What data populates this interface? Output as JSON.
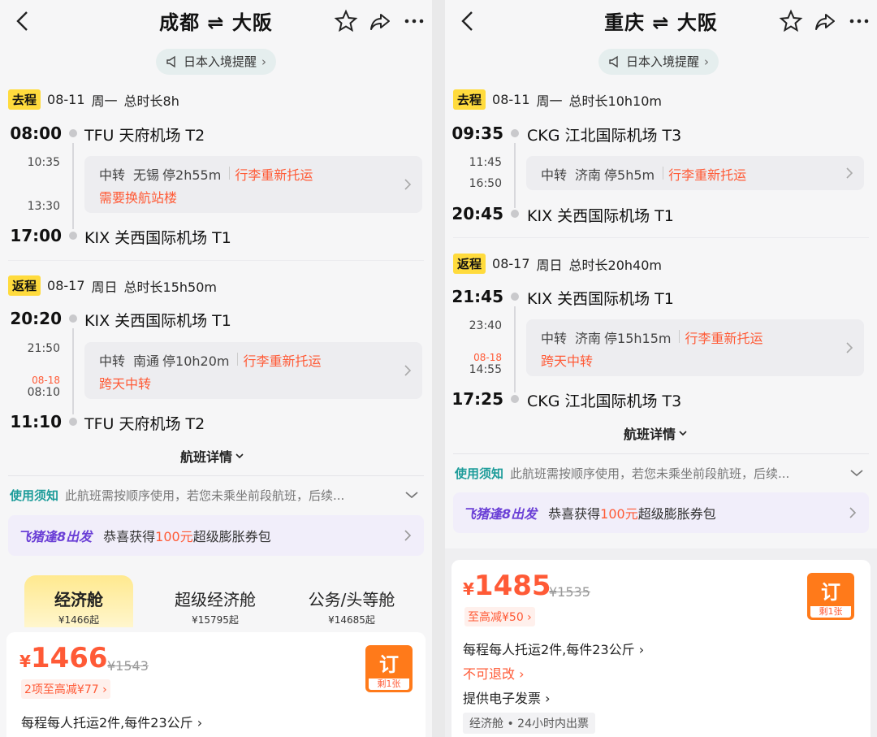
{
  "left": {
    "title": "成都 ⇌ 大阪",
    "notice": "日本入境提醒",
    "outbound": {
      "tag": "去程",
      "date": "08-11",
      "weekday": "周一",
      "duration": "总时长8h",
      "dep_time": "08:00",
      "dep_airport": "TFU 天府机场 T2",
      "arr_time_stop": "10:35",
      "dep_time_stop": "13:30",
      "transfer_label": "中转",
      "transfer_city": "无锡",
      "stop_duration": "停2h55m",
      "baggage": "行李重新托运",
      "warning": "需要换航站楼",
      "arr_time": "17:00",
      "arr_airport": "KIX 关西国际机场 T1"
    },
    "return": {
      "tag": "返程",
      "date": "08-17",
      "weekday": "周日",
      "duration": "总时长15h50m",
      "dep_time": "20:20",
      "dep_airport": "KIX 关西国际机场 T1",
      "arr_time_stop": "21:50",
      "next_day": "08-18",
      "dep_time_stop": "08:10",
      "transfer_label": "中转",
      "transfer_city": "南通",
      "stop_duration": "停10h20m",
      "baggage": "行李重新托运",
      "warning": "跨天中转",
      "arr_time": "11:10",
      "arr_airport": "TFU 天府机场 T2"
    },
    "details_link": "航班详情",
    "rule_label": "使用须知",
    "rule_text": "此航班需按顺序使用，若您未乘坐前段航班，后续...",
    "promo_logo": "飞猪逢8出发",
    "promo_pre": "恭喜获得",
    "promo_amount": "100元",
    "promo_post": "超级膨胀券包",
    "cabins": [
      {
        "name": "经济舱",
        "price": "¥1466起"
      },
      {
        "name": "超级经济舱",
        "price": "¥15795起"
      },
      {
        "name": "公务/头等舱",
        "price": "¥14685起"
      }
    ],
    "price_currency": "¥",
    "price": "1466",
    "orig_price": "¥1543",
    "discount": "2项至高减¥77",
    "book_label": "订",
    "remaining": "剩1张",
    "baggage_info": "每程每人托运2件,每件23公斤"
  },
  "right": {
    "title": "重庆 ⇌ 大阪",
    "notice": "日本入境提醒",
    "outbound": {
      "tag": "去程",
      "date": "08-11",
      "weekday": "周一",
      "duration": "总时长10h10m",
      "dep_time": "09:35",
      "dep_airport": "CKG 江北国际机场 T3",
      "arr_time_stop": "11:45",
      "dep_time_stop": "16:50",
      "transfer_label": "中转",
      "transfer_city": "济南",
      "stop_duration": "停5h5m",
      "baggage": "行李重新托运",
      "arr_time": "20:45",
      "arr_airport": "KIX 关西国际机场 T1"
    },
    "return": {
      "tag": "返程",
      "date": "08-17",
      "weekday": "周日",
      "duration": "总时长20h40m",
      "dep_time": "21:45",
      "dep_airport": "KIX 关西国际机场 T1",
      "arr_time_stop": "23:40",
      "next_day": "08-18",
      "dep_time_stop": "14:55",
      "transfer_label": "中转",
      "transfer_city": "济南",
      "stop_duration": "停15h15m",
      "baggage": "行李重新托运",
      "warning": "跨天中转",
      "arr_time": "17:25",
      "arr_airport": "CKG 江北国际机场 T3"
    },
    "details_link": "航班详情",
    "rule_label": "使用须知",
    "rule_text": "此航班需按顺序使用，若您未乘坐前段航班，后续...",
    "promo_logo": "飞猪逢8出发",
    "promo_pre": "恭喜获得",
    "promo_amount": "100元",
    "promo_post": "超级膨胀券包",
    "price_currency": "¥",
    "price": "1485",
    "orig_price": "¥1535",
    "discount": "至高减¥50",
    "book_label": "订",
    "remaining": "剩1张",
    "baggage_info": "每程每人托运2件,每件23公斤",
    "refund_info": "不可退改",
    "invoice_info": "提供电子发票",
    "cabin_tag": "经济舱 • 24小时内出票"
  },
  "colors": {
    "accent_red": "#ff5a36",
    "tag_yellow": "#ffdb3d",
    "teal": "#1d9c9a",
    "book_orange": "#ff7a1a"
  }
}
